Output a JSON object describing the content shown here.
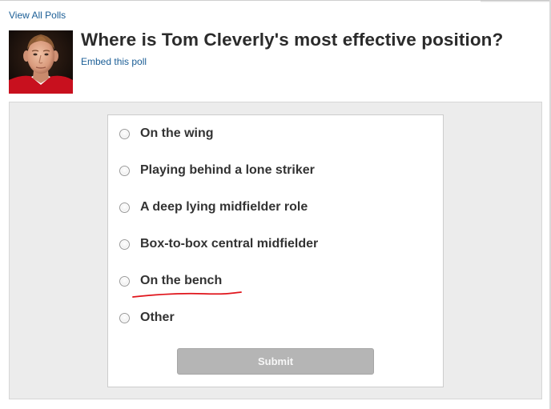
{
  "header": {
    "view_all_label": "View All Polls",
    "title": "Where is Tom Cleverly's most effective position?",
    "embed_label": "Embed this poll"
  },
  "poll": {
    "options": [
      {
        "label": "On the wing",
        "selected": false
      },
      {
        "label": "Playing behind a lone striker",
        "selected": false
      },
      {
        "label": "A deep lying midfielder role",
        "selected": false
      },
      {
        "label": "Box-to-box central midfielder",
        "selected": false
      },
      {
        "label": "On the bench",
        "selected": false,
        "annotated": true
      },
      {
        "label": "Other",
        "selected": false
      }
    ],
    "submit_label": "Submit"
  },
  "colors": {
    "link": "#1b5e96",
    "annotation": "#e0141b",
    "submit_bg": "#b5b5b5"
  }
}
